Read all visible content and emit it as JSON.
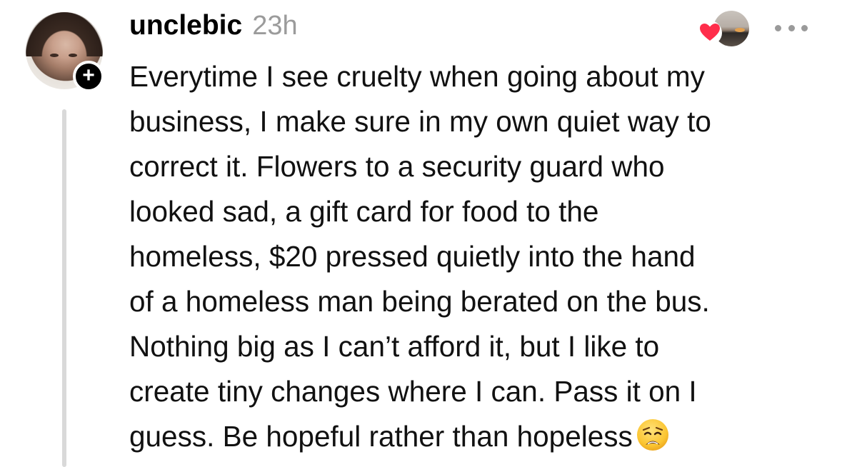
{
  "post": {
    "username": "unclebic",
    "time": "23h",
    "follow_symbol": "+",
    "lines": [
      "Everytime I see cruelty when going about my",
      "business, I make sure in my own quiet way to",
      "correct it. Flowers to a security guard who",
      "looked sad, a gift card for food to the",
      "homeless, $20 pressed quietly into the hand",
      "of a homeless man being berated on the bus.",
      "Nothing big as I can’t afford it, but I like to",
      "create tiny changes where I can. Pass it on I",
      "guess. Be hopeful rather than hopeless"
    ],
    "emoji": "weary-face-emoji"
  },
  "icons": {
    "avatar": "user-avatar",
    "follow": "plus-icon",
    "like": "heart-icon",
    "liker": "liker-avatar",
    "more": "more-dots-icon"
  },
  "colors": {
    "heart": "#ff2d4b",
    "time": "#9b9b9b",
    "thread_line": "#d9d9d9",
    "text": "#111111"
  }
}
